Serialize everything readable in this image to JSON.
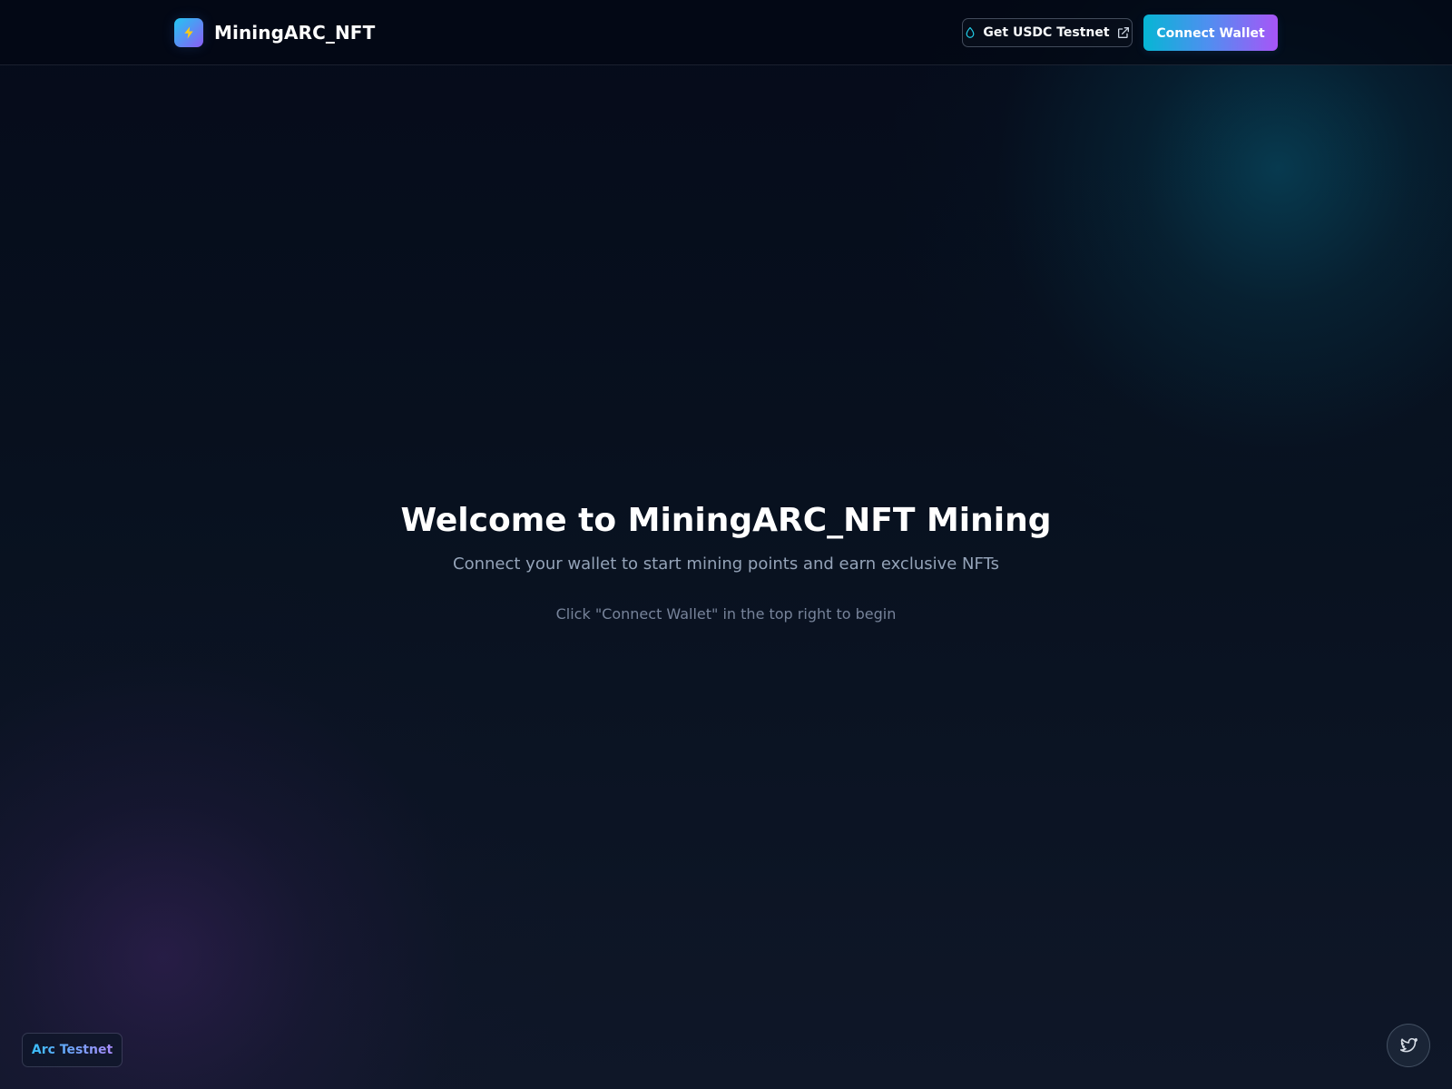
{
  "header": {
    "logo_icon": "lightning-bolt-icon",
    "title": "MiningARC_NFT",
    "faucet": {
      "label": "Get USDC Testnet",
      "leading_icon": "droplet-icon",
      "trailing_icon": "external-link-icon"
    },
    "connect_wallet_label": "Connect Wallet"
  },
  "hero": {
    "title": "Welcome to MiningARC_NFT Mining",
    "subtitle": "Connect your wallet to start mining points and earn exclusive NFTs",
    "instruction": "Click \"Connect Wallet\" in the top right to begin"
  },
  "footer": {
    "network_label": "Arc Testnet",
    "social_icon": "twitter-icon"
  },
  "colors": {
    "background": "#0b1222",
    "header_background": "#050b1a",
    "accent_cyan": "#06b6d4",
    "accent_purple": "#a855f7",
    "text_primary": "#ffffff",
    "text_secondary": "#94a3b8",
    "text_muted": "#77839a"
  }
}
